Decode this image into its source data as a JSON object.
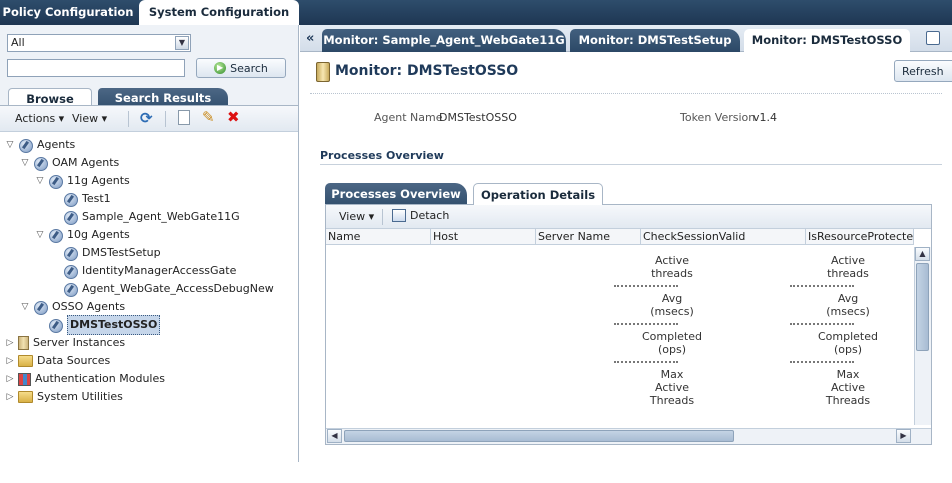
{
  "top_tabs": [
    {
      "label": "Policy Configuration",
      "active": false
    },
    {
      "label": "System Configuration",
      "active": true
    }
  ],
  "left": {
    "filter_select": {
      "value": "All"
    },
    "search_input": {
      "value": ""
    },
    "search_button": "Search",
    "tabs": [
      {
        "label": "Browse",
        "active": true
      },
      {
        "label": "Search Results",
        "active": false
      }
    ],
    "toolbar": {
      "actions": "Actions",
      "view": "View"
    },
    "tree": [
      {
        "label": "Agents",
        "twisty": "▽",
        "icon": "agent-icon"
      },
      {
        "label": "OAM Agents",
        "twisty": "▽",
        "icon": "agent-icon"
      },
      {
        "label": "11g Agents",
        "twisty": "▽",
        "icon": "agent-icon"
      },
      {
        "label": "Test1",
        "twisty": "",
        "icon": "agent-icon"
      },
      {
        "label": "Sample_Agent_WebGate11G",
        "twisty": "",
        "icon": "agent-icon"
      },
      {
        "label": "10g Agents",
        "twisty": "▽",
        "icon": "agent-icon"
      },
      {
        "label": "DMSTestSetup",
        "twisty": "",
        "icon": "agent-icon"
      },
      {
        "label": "IdentityManagerAccessGate",
        "twisty": "",
        "icon": "agent-icon"
      },
      {
        "label": "Agent_WebGate_AccessDebugNew",
        "twisty": "",
        "icon": "agent-icon"
      },
      {
        "label": "OSSO Agents",
        "twisty": "▽",
        "icon": "agent-icon"
      },
      {
        "label": "DMSTestOSSO",
        "twisty": "",
        "icon": "agent-icon",
        "selected": true
      },
      {
        "label": "Server Instances",
        "twisty": "▷",
        "icon": "server-icon"
      },
      {
        "label": "Data Sources",
        "twisty": "▷",
        "icon": "folder-icon"
      },
      {
        "label": "Authentication Modules",
        "twisty": "▷",
        "icon": "auth-icon"
      },
      {
        "label": "System Utilities",
        "twisty": "▷",
        "icon": "folder-icon"
      }
    ]
  },
  "right": {
    "collapse_glyph": "«",
    "monitor_tabs": [
      {
        "label": "Monitor: Sample_Agent_WebGate11G",
        "active": false
      },
      {
        "label": "Monitor: DMSTestSetup",
        "active": false
      },
      {
        "label": "Monitor: DMSTestOSSO",
        "active": true
      }
    ],
    "page_title": "Monitor: DMSTestOSSO",
    "refresh_button": "Refresh",
    "agent_name_label": "Agent Name",
    "agent_name_value": "DMSTestOSSO",
    "token_version_label": "Token Version",
    "token_version_value": "v1.4",
    "section_title": "Processes Overview",
    "ops_tabs": [
      {
        "label": "Processes Overview",
        "active": false
      },
      {
        "label": "Operation Details",
        "active": true
      }
    ],
    "ops_toolbar": {
      "view": "View",
      "detach": "Detach"
    },
    "columns": [
      "Name",
      "Host",
      "Server Name",
      "CheckSessionValid",
      "IsResourceProtected"
    ],
    "metrics": [
      {
        "line1": "Active",
        "line2": "threads",
        "line3": ""
      },
      {
        "line1": "Avg",
        "line2": "(msecs)",
        "line3": ""
      },
      {
        "line1": "Completed",
        "line2": "(ops)",
        "line3": ""
      },
      {
        "line1": "Max",
        "line2": "Active",
        "line3": "Threads"
      }
    ]
  }
}
